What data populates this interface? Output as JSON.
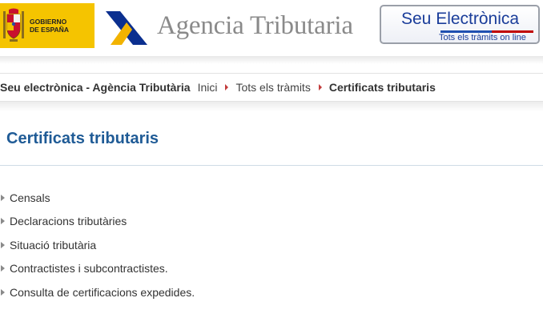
{
  "header": {
    "gov_logo_text": [
      "GOBIERNO",
      "DE ESPAÑA"
    ],
    "agency_name": "Agencia Tributaria",
    "seu": {
      "title_part1": "Seu ",
      "title_part2": "Electrònica",
      "subtitle": "Tots els tràmits on line"
    }
  },
  "breadcrumb": {
    "site": "Seu electrònica - Agència Tributària",
    "items": [
      "Inici",
      "Tots els tràmits"
    ],
    "current": "Certificats tributaris"
  },
  "page": {
    "title": "Certificats tributaris"
  },
  "procedures": [
    "Censals",
    "Declaracions tributàries",
    "Situació tributària",
    "Contractistes i subcontractistes.",
    "Consulta de certificacions expedides."
  ],
  "colors": {
    "gov_yellow": "#f5c400",
    "title_blue": "#1f5b96",
    "seu_blue": "#1a3d9a",
    "breadcrumb_arrow": "#c23b3b"
  }
}
